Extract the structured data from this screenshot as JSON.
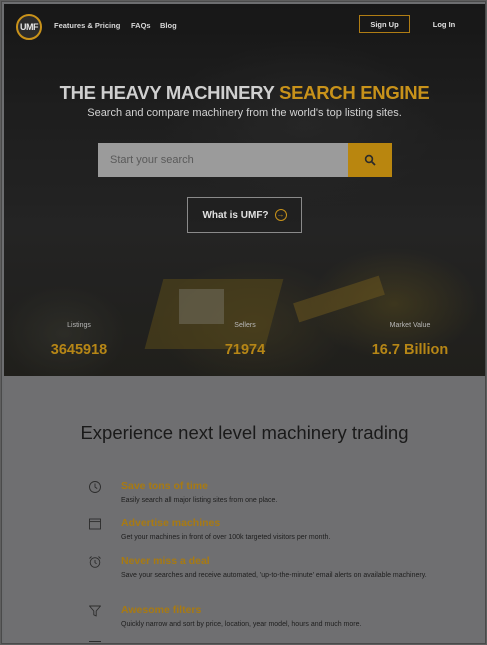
{
  "nav": {
    "logo_text": "UMF",
    "links": [
      "Features & Pricing",
      "FAQs",
      "Blog"
    ],
    "signup_label": "Sign Up",
    "login_label": "Log In"
  },
  "hero": {
    "headline_part1": "THE HEAVY MACHINERY ",
    "headline_part2": "SEARCH ENGINE",
    "subheadline": "Search and compare machinery from the world's top listing sites.",
    "search_placeholder": "Start your search",
    "what_is_label": "What is UMF?"
  },
  "stats": [
    {
      "label": "Listings",
      "value": "3645918"
    },
    {
      "label": "Sellers",
      "value": "71974"
    },
    {
      "label": "Market Value",
      "value": "16.7 Billion"
    }
  ],
  "features_section": {
    "title": "Experience next level machinery trading",
    "items": [
      {
        "icon": "clock-icon",
        "title": "Save tons of time",
        "desc": "Easily search all major listing sites from one place."
      },
      {
        "icon": "browser-window-icon",
        "title": "Advertise machines",
        "desc": "Get your machines in front of over 100k targeted visitors per month."
      },
      {
        "icon": "alarm-clock-icon",
        "title": "Never miss a deal",
        "desc": "Save your searches and receive automated, 'up-to-the-minute' email alerts on available machinery."
      },
      {
        "icon": "filter-icon",
        "title": "Awesome filters",
        "desc": "Quickly narrow and sort by price, location, year model, hours and much more."
      }
    ]
  },
  "colors": {
    "accent": "#c8921a",
    "search_button": "#b9860f",
    "page_bg": "#6f6f71"
  }
}
